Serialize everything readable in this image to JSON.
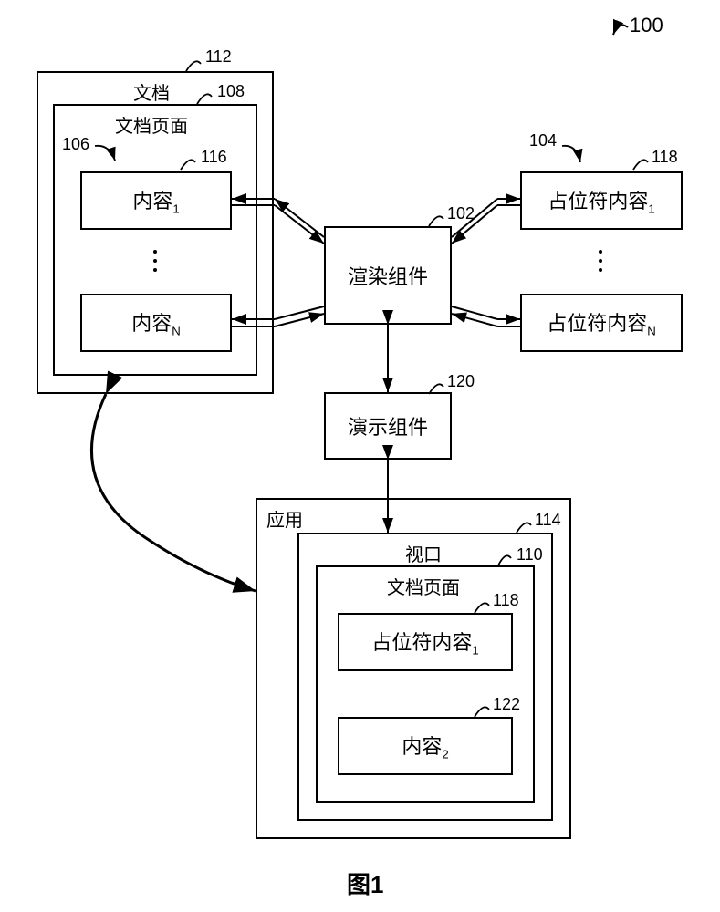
{
  "figure_ref": "100",
  "figure_label": "图1",
  "refs": {
    "r112": "112",
    "r108": "108",
    "r106": "106",
    "r116": "116",
    "r102": "102",
    "r104": "104",
    "r118_top": "118",
    "r120": "120",
    "r114": "114",
    "r110": "110",
    "r118_view": "118",
    "r122": "122"
  },
  "labels": {
    "document": "文档",
    "document_page_top": "文档页面",
    "content_1_prefix": "内容",
    "content_1_sub": "1",
    "content_n_prefix": "内容",
    "content_n_sub": "N",
    "render_component": "渲染组件",
    "placeholder_1_prefix": "占位符内容",
    "placeholder_1_sub": "1",
    "placeholder_n_prefix": "占位符内容",
    "placeholder_n_sub": "N",
    "present_component": "演示组件",
    "application": "应用",
    "viewport": "视口",
    "document_page_view": "文档页面",
    "view_placeholder_prefix": "占位符内容",
    "view_placeholder_sub": "1",
    "view_content_prefix": "内容",
    "view_content_sub": "2"
  }
}
